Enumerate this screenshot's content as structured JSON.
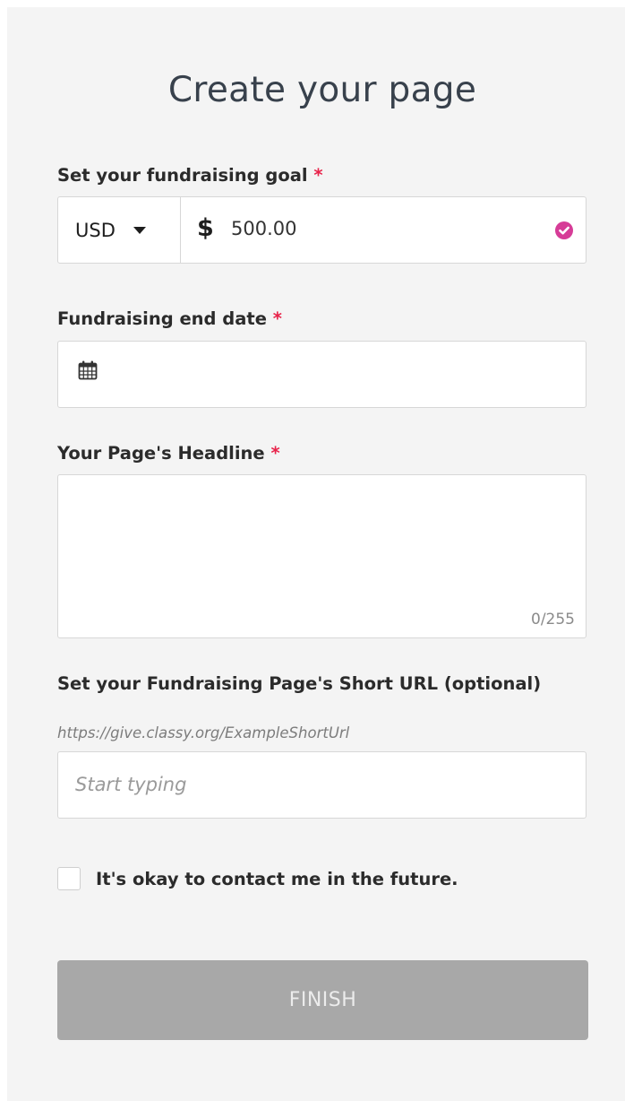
{
  "title": "Create your page",
  "goal": {
    "label": "Set your fundraising goal",
    "required_mark": "*",
    "currency": "USD",
    "symbol": "$",
    "amount": "500.00",
    "valid_icon": "check-circle-icon",
    "accent": "#d63c97"
  },
  "end_date": {
    "label": "Fundraising end date",
    "required_mark": "*",
    "icon": "calendar-icon"
  },
  "headline": {
    "label": "Your Page's Headline",
    "required_mark": "*",
    "counter": "0/255"
  },
  "short_url": {
    "label": "Set your Fundraising Page's Short URL (optional)",
    "hint": "https://give.classy.org/ExampleShortUrl",
    "placeholder": "Start typing"
  },
  "contact": {
    "label": "It's okay to contact me in the future.",
    "checked": false
  },
  "finish": {
    "label": "FINISH",
    "color": "#a8a8a8"
  },
  "colors": {
    "required": "#e8234a"
  }
}
